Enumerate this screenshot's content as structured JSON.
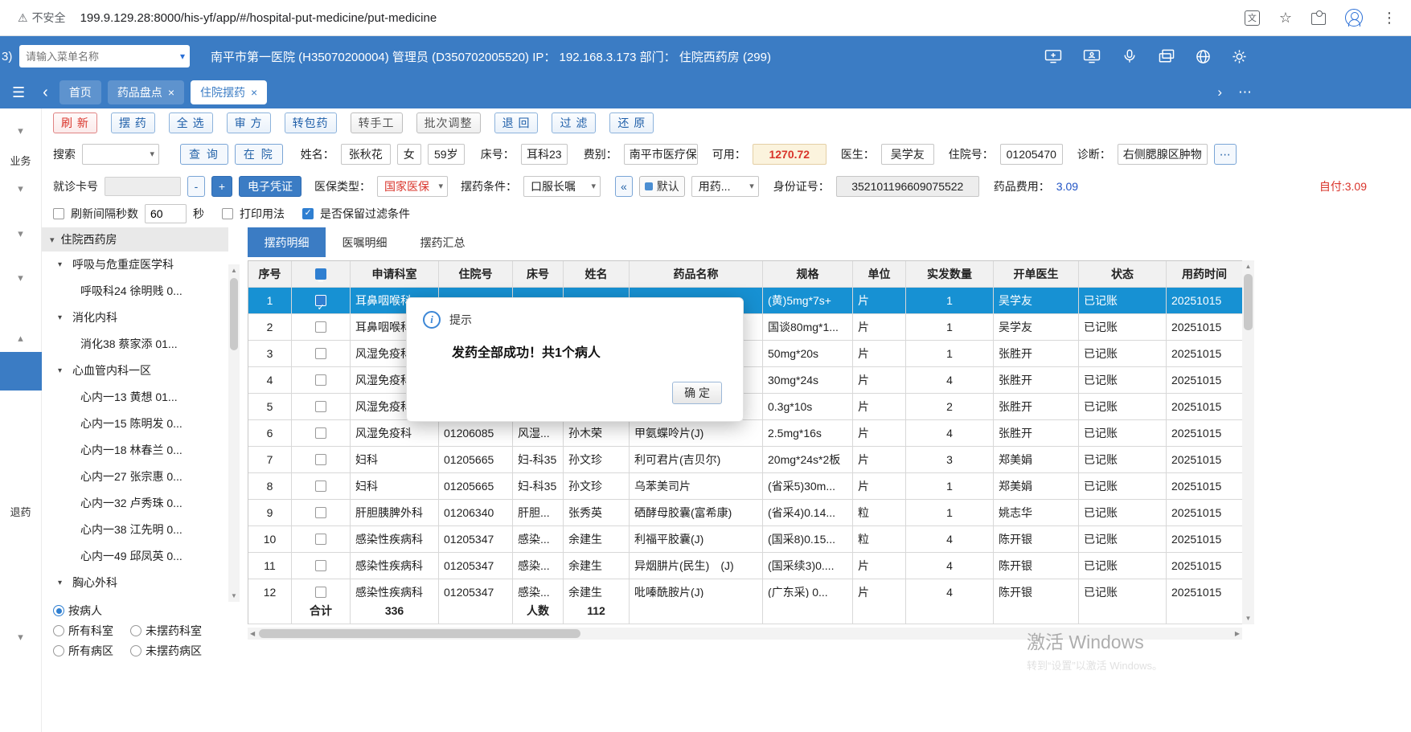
{
  "colors": {
    "accent": "#3b7cc4",
    "sel": "#1791d3",
    "danger": "#d9342b",
    "fee-blue": "#2053c5"
  },
  "icons": {
    "warning": "⚠",
    "star": "☆",
    "menu_kebab": "⋮",
    "translate": "文",
    "hamburger": "☰",
    "back": "‹",
    "forward": "›",
    "more": "⋯",
    "caret": "▾",
    "caret_up": "▴",
    "up": "▲",
    "down": "▼",
    "left": "◀",
    "right": "▶",
    "collapse": "«",
    "info": "i"
  },
  "browser": {
    "warning_label": "不安全",
    "url": "199.9.129.28:8000/his-yf/app/#/hospital-put-medicine/put-medicine"
  },
  "header": {
    "badge": "3)",
    "search_placeholder": "请输入菜单名称",
    "info": "南平市第一医院 (H35070200004) 管理员 (D350702005520) IP： 192.168.3.173 部门： 住院西药房 (299)"
  },
  "nav": {
    "tabs": [
      {
        "label": "首页",
        "close": "",
        "cls": ""
      },
      {
        "label": "药品盘点",
        "close": "×",
        "cls": ""
      },
      {
        "label": "住院摆药",
        "close": "×",
        "cls": "active"
      }
    ]
  },
  "rail": {
    "business_label": "业务",
    "return_label": "退药"
  },
  "toolbar": {
    "buttons": [
      {
        "label": "刷 新",
        "cls": "btn-red"
      },
      {
        "label": "摆 药",
        "cls": "btn-blue"
      },
      {
        "label": "全 选",
        "cls": "btn-blue"
      },
      {
        "label": "审 方",
        "cls": "btn-blue"
      },
      {
        "label": "转包药",
        "cls": "btn-blue"
      },
      {
        "label": "转手工",
        "cls": "btn-gray"
      },
      {
        "label": "批次调整",
        "cls": "btn-gray"
      },
      {
        "label": "退 回",
        "cls": "btn-blue"
      },
      {
        "label": "过 滤",
        "cls": "btn-blue"
      },
      {
        "label": "还 原",
        "cls": "btn-blue"
      }
    ]
  },
  "filter1": {
    "search_label": "搜索",
    "query_btn": "查 询",
    "inpatient_btn": "在 院",
    "name_label": "姓名：",
    "name_value": "张秋花",
    "gender_value": "女",
    "age_value": "59岁",
    "bed_label": "床号：",
    "bed_value": "耳科23",
    "fee_type_label": "费别：",
    "fee_type_value": "南平市医疗保",
    "balance_label": "可用：",
    "balance_value": "1270.72",
    "doctor_label": "医生：",
    "doctor_value": "吴学友",
    "admission_label": "住院号：",
    "admission_value": "01205470",
    "diagnosis_label": "诊断：",
    "diagnosis_value": "右侧腮腺区肿物"
  },
  "filter2": {
    "card_label": "就诊卡号",
    "minus_btn": "-",
    "plus_btn": "+",
    "ecert_btn": "电子凭证",
    "insurance_label": "医保类型：",
    "insurance_value": "国家医保",
    "condition_label": "摆药条件：",
    "condition_value": "口服长嘱",
    "default_btn": "默认",
    "usage_value": "用药...",
    "idcard_label": "身份证号：",
    "idcard_value": "352101196609075522",
    "drugfee_label": "药品费用：",
    "drugfee_value": "3.09",
    "selfpay_label": "自付:",
    "selfpay_value": "3.09"
  },
  "filter3": {
    "interval_label": "刷新间隔秒数",
    "interval_value": "60",
    "seconds_label": "秒",
    "print_label": "打印用法",
    "keep_filter_label": "是否保留过滤条件"
  },
  "sidebar": {
    "header": "住院西药房",
    "tree": [
      {
        "label": "呼吸与危重症医学科",
        "cls": "parent"
      },
      {
        "label": "呼吸科24 徐明贱 0...",
        "cls": "child"
      },
      {
        "label": "消化内科",
        "cls": "parent"
      },
      {
        "label": "消化38 蔡家添 01...",
        "cls": "child"
      },
      {
        "label": "心血管内科一区",
        "cls": "parent"
      },
      {
        "label": "心内一13 黄想 01...",
        "cls": "child"
      },
      {
        "label": "心内一15 陈明发 0...",
        "cls": "child"
      },
      {
        "label": "心内一18 林春兰 0...",
        "cls": "child"
      },
      {
        "label": "心内一27 张宗惠 0...",
        "cls": "child"
      },
      {
        "label": "心内一32 卢秀珠 0...",
        "cls": "child"
      },
      {
        "label": "心内一38 江先明 0...",
        "cls": "child"
      },
      {
        "label": "心内一49 邱凤英 0...",
        "cls": "child"
      },
      {
        "label": "胸心外科",
        "cls": "parent"
      }
    ],
    "radios": [
      {
        "label": "按病人",
        "state": "checked",
        "cls": "full"
      },
      {
        "label": "所有科室",
        "state": "",
        "cls": ""
      },
      {
        "label": "未摆药科室",
        "state": "",
        "cls": ""
      },
      {
        "label": "所有病区",
        "state": "",
        "cls": ""
      },
      {
        "label": "未摆药病区",
        "state": "",
        "cls": ""
      }
    ]
  },
  "panel": {
    "tabs": [
      {
        "label": "摆药明细",
        "cls": "active"
      },
      {
        "label": "医嘱明细",
        "cls": ""
      },
      {
        "label": "摆药汇总",
        "cls": ""
      }
    ]
  },
  "table": {
    "headers": [
      "序号",
      "",
      "申请科室",
      "住院号",
      "床号",
      "姓名",
      "药品名称",
      "规格",
      "单位",
      "实发数量",
      "开单医生",
      "状态",
      "用药时间"
    ],
    "rows": [
      {
        "seq": "1",
        "cb": "checked",
        "dept": "耳鼻咽喉科",
        "adm": "",
        "bed": "",
        "name": "",
        "drug": "",
        "spec": "(黄)5mg*7s+",
        "unit": "片",
        "qty": "1",
        "doctor": "吴学友",
        "status": "已记账",
        "date": "20251015",
        "cls": "selected"
      },
      {
        "seq": "2",
        "cb": "",
        "dept": "耳鼻咽喉科",
        "adm": "",
        "bed": "",
        "name": "",
        "drug": "",
        "spec": "国谈80mg*1...",
        "unit": "片",
        "qty": "1",
        "doctor": "吴学友",
        "status": "已记账",
        "date": "20251015",
        "cls": ""
      },
      {
        "seq": "3",
        "cb": "",
        "dept": "风湿免疫科",
        "adm": "",
        "bed": "",
        "name": "",
        "drug": "",
        "spec": "50mg*20s",
        "unit": "片",
        "qty": "1",
        "doctor": "张胜开",
        "status": "已记账",
        "date": "20251015",
        "cls": ""
      },
      {
        "seq": "4",
        "cb": "",
        "dept": "风湿免疫科",
        "adm": "",
        "bed": "",
        "name": "",
        "drug": "",
        "spec": "30mg*24s",
        "unit": "片",
        "qty": "4",
        "doctor": "张胜开",
        "status": "已记账",
        "date": "20251015",
        "cls": ""
      },
      {
        "seq": "5",
        "cb": "",
        "dept": "风湿免疫科",
        "adm": "",
        "bed": "",
        "name": "",
        "drug": "",
        "spec": "0.3g*10s",
        "unit": "片",
        "qty": "2",
        "doctor": "张胜开",
        "status": "已记账",
        "date": "20251015",
        "cls": ""
      },
      {
        "seq": "6",
        "cb": "",
        "dept": "风湿免疫科",
        "adm": "01206085",
        "bed": "风湿...",
        "name": "孙木荣",
        "drug": "甲氨蝶呤片(J)",
        "spec": "2.5mg*16s",
        "unit": "片",
        "qty": "4",
        "doctor": "张胜开",
        "status": "已记账",
        "date": "20251015",
        "cls": ""
      },
      {
        "seq": "7",
        "cb": "",
        "dept": "妇科",
        "adm": "01205665",
        "bed": "妇-科35",
        "name": "孙文珍",
        "drug": "利可君片(吉贝尔)",
        "spec": "20mg*24s*2板",
        "unit": "片",
        "qty": "3",
        "doctor": "郑美娟",
        "status": "已记账",
        "date": "20251015",
        "cls": ""
      },
      {
        "seq": "8",
        "cb": "",
        "dept": "妇科",
        "adm": "01205665",
        "bed": "妇-科35",
        "name": "孙文珍",
        "drug": "乌苯美司片",
        "spec": "(省采5)30m...",
        "unit": "片",
        "qty": "1",
        "doctor": "郑美娟",
        "status": "已记账",
        "date": "20251015",
        "cls": ""
      },
      {
        "seq": "9",
        "cb": "",
        "dept": "肝胆胰脾外科",
        "adm": "01206340",
        "bed": "肝胆...",
        "name": "张秀英",
        "drug": "硒酵母胶囊(富希康)",
        "spec": "(省采4)0.14...",
        "unit": "粒",
        "qty": "1",
        "doctor": "姚志华",
        "status": "已记账",
        "date": "20251015",
        "cls": ""
      },
      {
        "seq": "10",
        "cb": "",
        "dept": "感染性疾病科",
        "adm": "01205347",
        "bed": "感染...",
        "name": "余建生",
        "drug": "利福平胶囊(J)",
        "spec": "(国采8)0.15...",
        "unit": "粒",
        "qty": "4",
        "doctor": "陈开银",
        "status": "已记账",
        "date": "20251015",
        "cls": ""
      },
      {
        "seq": "11",
        "cb": "",
        "dept": "感染性疾病科",
        "adm": "01205347",
        "bed": "感染...",
        "name": "余建生",
        "drug": "异烟肼片(民生)　(J)",
        "spec": "(国采续3)0....",
        "unit": "片",
        "qty": "4",
        "doctor": "陈开银",
        "status": "已记账",
        "date": "20251015",
        "cls": ""
      },
      {
        "seq": "12",
        "cb": "",
        "dept": "感染性疾病科",
        "adm": "01205347",
        "bed": "感染...",
        "name": "余建生",
        "drug": "吡嗪酰胺片(J)",
        "spec": "(广东采) 0...",
        "unit": "片",
        "qty": "4",
        "doctor": "陈开银",
        "status": "已记账",
        "date": "20251015",
        "cls": ""
      }
    ],
    "summary": [
      "",
      "合计",
      "336",
      "",
      "人数",
      "112",
      "",
      "",
      "",
      "",
      "",
      "",
      ""
    ]
  },
  "dialog": {
    "title": "提示",
    "message": "发药全部成功！共1个病人",
    "ok_label": "确 定"
  },
  "watermark": {
    "line1": "激活 Windows",
    "line2": "转到“设置”以激活 Windows。"
  }
}
